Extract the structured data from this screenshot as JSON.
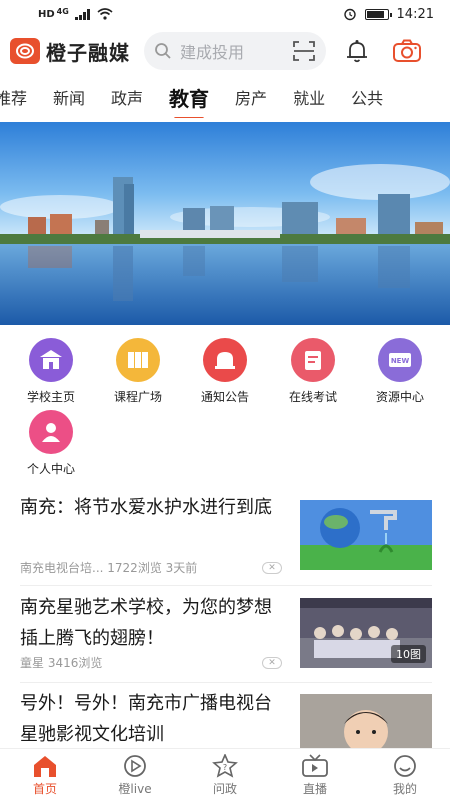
{
  "status_bar": {
    "network": "HD",
    "signal": "4G",
    "time": "14:21",
    "battery_level": 0.8
  },
  "header": {
    "app_name": "橙子融媒",
    "search_placeholder": "建成投用"
  },
  "tabs": [
    "推荐",
    "新闻",
    "政声",
    "教育",
    "房产",
    "就业",
    "公共"
  ],
  "active_tab": "教育",
  "functions": [
    {
      "label": "学校主页",
      "color": "#8a5cd8",
      "icon": "school-icon"
    },
    {
      "label": "课程广场",
      "color": "#f4b73a",
      "icon": "course-icon"
    },
    {
      "label": "通知公告",
      "color": "#ea4a4a",
      "icon": "bell-notice-icon"
    },
    {
      "label": "在线考试",
      "color": "#ea5a6a",
      "icon": "exam-icon"
    },
    {
      "label": "资源中心",
      "color": "#8a6cd8",
      "icon": "resource-new-icon"
    },
    {
      "label": "个人中心",
      "color": "#ec4f86",
      "icon": "person-icon"
    }
  ],
  "news": [
    {
      "title": "南充：将节水爱水护水进行到底",
      "source": "南充电视台培...",
      "views": "1722浏览",
      "time": "3天前"
    },
    {
      "title": "南充星驰艺术学校，为您的梦想插上腾飞的翅膀！",
      "source": "童星",
      "views": "3416浏览",
      "image_count": "10图"
    },
    {
      "title": "号外！号外！南充市广播电视台星驰影视文化培训"
    }
  ],
  "close_glyph": "✕",
  "bottom_nav": [
    {
      "label": "首页",
      "icon": "home-icon"
    },
    {
      "label": "橙live",
      "icon": "live-icon"
    },
    {
      "label": "问政",
      "icon": "question-icon"
    },
    {
      "label": "直播",
      "icon": "tv-icon"
    },
    {
      "label": "我的",
      "icon": "profile-icon"
    }
  ],
  "colors": {
    "accent": "#e8502d"
  }
}
